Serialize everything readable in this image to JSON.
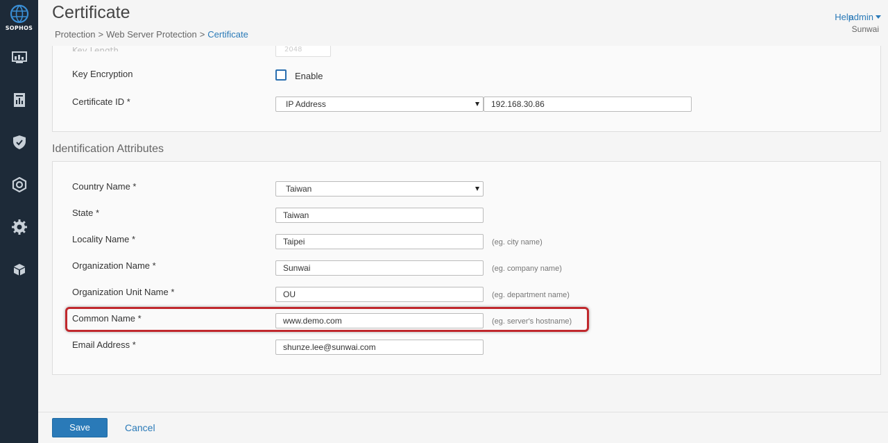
{
  "brand": {
    "logo_text": "SOPHOS"
  },
  "sidebar": {
    "items": [
      {
        "icon": "monitor-icon"
      },
      {
        "icon": "reports-icon"
      },
      {
        "icon": "shield-icon"
      },
      {
        "icon": "diagnostics-icon"
      },
      {
        "icon": "gear-icon"
      },
      {
        "icon": "box-icon"
      }
    ]
  },
  "header": {
    "title": "Certificate",
    "breadcrumb": [
      "Protection",
      "Web Server Protection",
      "Certificate"
    ],
    "breadcrumb_sep": ">",
    "help": "Help",
    "user": "admin",
    "org": "Sunwai"
  },
  "top_panel": {
    "faded_value": "2048",
    "key_encryption_label": "Key Encryption",
    "key_encryption_checkbox_label": "Enable",
    "key_encryption_checked": false,
    "certificate_id_label": "Certificate ID *",
    "certificate_id_type": "IP Address",
    "certificate_id_value": "192.168.30.86"
  },
  "identification": {
    "section_title": "Identification Attributes",
    "country_label": "Country Name *",
    "country_value": "Taiwan",
    "state_label": "State *",
    "state_value": "Taiwan",
    "locality_label": "Locality Name *",
    "locality_value": "Taipei",
    "locality_hint": "(eg. city name)",
    "org_label": "Organization Name *",
    "org_value": "Sunwai",
    "org_hint": "(eg. company name)",
    "org_unit_label": "Organization Unit Name *",
    "org_unit_value": "OU",
    "org_unit_hint": "(eg. department name)",
    "common_name_label": "Common Name *",
    "common_name_value": "www.demo.com",
    "common_name_hint": "(eg. server's hostname)",
    "email_label": "Email Address *",
    "email_value": "shunze.lee@sunwai.com"
  },
  "footer": {
    "save": "Save",
    "cancel": "Cancel"
  },
  "colors": {
    "sidebar_bg": "#1d2a38",
    "accent": "#2a7ab8",
    "highlight": "#c0282d"
  }
}
